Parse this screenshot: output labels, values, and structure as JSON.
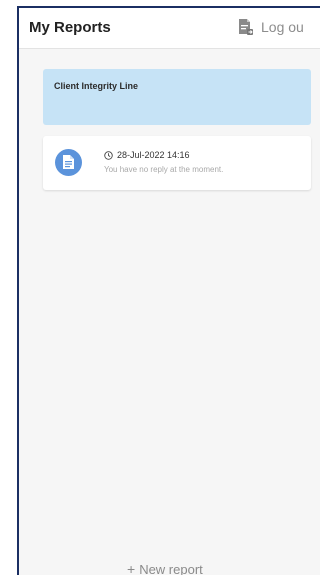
{
  "header": {
    "title": "My Reports",
    "logout_label": "Log ou"
  },
  "banner": {
    "label": "Client Integrity Line"
  },
  "reports": [
    {
      "date": "28-Jul-2022 14:16",
      "status": "You have no reply at the moment."
    }
  ],
  "footer": {
    "new_report_label": "New report"
  },
  "icons": {
    "logout": "logout-document-icon",
    "report": "document-icon",
    "date": "clock-icon",
    "add": "plus-icon"
  },
  "colors": {
    "frame_border": "#1b2f63",
    "banner_bg": "#c6e3f6",
    "avatar_bg": "#5b93db",
    "page_bg": "#f6f6f6"
  }
}
